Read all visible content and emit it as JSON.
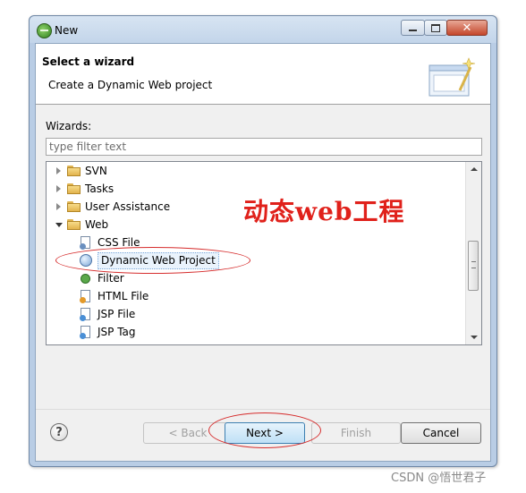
{
  "window": {
    "title": "New"
  },
  "header": {
    "title": "Select a wizard",
    "description": "Create a Dynamic Web project"
  },
  "wizards_label": "Wizards:",
  "filter": {
    "placeholder": "type filter text",
    "value": ""
  },
  "tree": {
    "items": [
      {
        "label": "SVN",
        "type": "folder",
        "expanded": false
      },
      {
        "label": "Tasks",
        "type": "folder",
        "expanded": false
      },
      {
        "label": "User Assistance",
        "type": "folder",
        "expanded": false
      },
      {
        "label": "Web",
        "type": "folder",
        "expanded": true
      },
      {
        "label": "CSS File",
        "type": "file",
        "icon": "css-file-icon"
      },
      {
        "label": "Dynamic Web Project",
        "type": "file",
        "icon": "web-project-icon",
        "selected": true
      },
      {
        "label": "Filter",
        "type": "file",
        "icon": "filter-icon"
      },
      {
        "label": "HTML File",
        "type": "file",
        "icon": "html-file-icon"
      },
      {
        "label": "JSP File",
        "type": "file",
        "icon": "jsp-file-icon"
      },
      {
        "label": "JSP Tag",
        "type": "file",
        "icon": "jsp-tag-icon"
      }
    ]
  },
  "buttons": {
    "help": "?",
    "back": "< Back",
    "next": "Next >",
    "finish": "Finish",
    "cancel": "Cancel"
  },
  "annotation": "动态web工程",
  "watermark": "CSDN @悟世君子",
  "colors": {
    "annotation": "#e0211b",
    "titlebar": "#c3d5ea",
    "close_button": "#c4462b"
  }
}
